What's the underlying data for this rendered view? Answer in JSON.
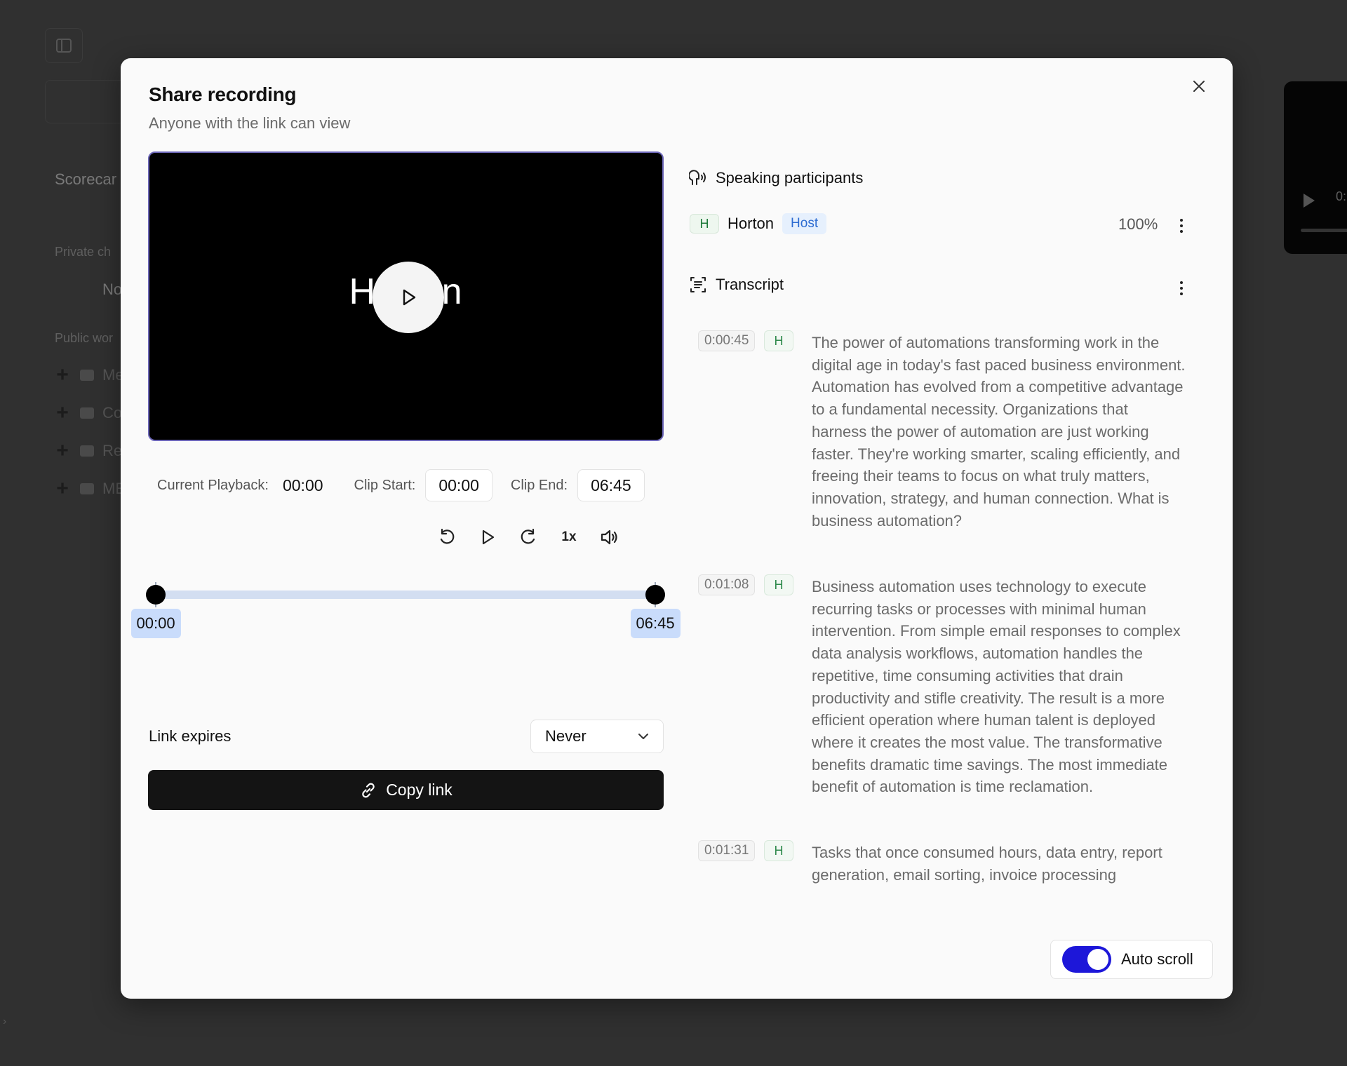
{
  "background": {
    "section_scorecards": "Scorecar",
    "section_private": "Private ch",
    "private_item": "No",
    "section_public": "Public wor",
    "public_items": [
      "Me",
      "Co",
      "Re",
      "ME"
    ],
    "video_time": "0:"
  },
  "modal": {
    "title": "Share recording",
    "subtitle": "Anyone with the link can view",
    "video_overlay_name": "Horton",
    "current_playback_label": "Current Playback:",
    "current_playback_value": "00:00",
    "clip_start_label": "Clip Start:",
    "clip_start_value": "00:00",
    "clip_end_label": "Clip End:",
    "clip_end_value": "06:45",
    "speed": "1x",
    "range": {
      "start_label": "00:00",
      "end_label": "06:45",
      "start_fraction": 0.0,
      "end_fraction": 1.0
    },
    "link_expires_label": "Link expires",
    "link_expires_value": "Never",
    "copy_link_label": "Copy link"
  },
  "participants": {
    "heading": "Speaking participants",
    "items": [
      {
        "initial": "H",
        "name": "Horton",
        "role": "Host",
        "percent": "100%"
      }
    ]
  },
  "transcript": {
    "heading": "Transcript",
    "entries": [
      {
        "time": "0:00:45",
        "speaker": "H",
        "text": "The power of automations transforming work in the digital age in today's fast paced business environment. Automation has evolved from a competitive advantage to a fundamental necessity. Organizations that harness the power of automation are just working faster. They're working smarter, scaling efficiently, and freeing their teams to focus on what truly matters, innovation, strategy, and human connection. What is business automation?"
      },
      {
        "time": "0:01:08",
        "speaker": "H",
        "text": "Business automation uses technology to execute recurring tasks or processes with minimal human intervention. From simple email responses to complex data analysis workflows, automation handles the repetitive, time consuming activities that drain productivity and stifle creativity. The result is a more efficient operation where human talent is deployed where it creates the most value. The transformative benefits dramatic time savings. The most immediate benefit of automation is time reclamation."
      },
      {
        "time": "0:01:31",
        "speaker": "H",
        "text": "Tasks that once consumed hours, data entry, report generation, email sorting, invoice processing"
      }
    ]
  },
  "auto_scroll": {
    "label": "Auto scroll",
    "enabled": true
  },
  "colors": {
    "accent": "#1d17d9",
    "host_badge": "#2c6bd1",
    "speaker_green": "#2f8a4c",
    "range_badge": "#c9dcfb"
  }
}
